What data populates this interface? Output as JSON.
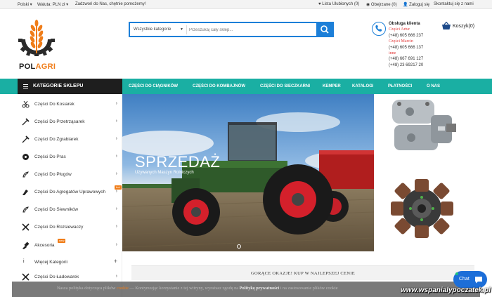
{
  "topbar": {
    "language": "Polski",
    "currency": "Waluta: PLN zł",
    "slogan": "Zadzwoń do Nas, chętnie pomożemy!",
    "wishlist": "Lista Ulubionych (0)",
    "viewed": "Obejrzane (0)",
    "login": "Zaloguj się",
    "contact": "Skontaktuj się z nami"
  },
  "logo": {
    "part1": "POL",
    "part2": "AGRI",
    "accent_color": "#f07d19"
  },
  "search": {
    "category": "Wszystkie kategorie",
    "placeholder": "Przeszukaj cały sklep...",
    "button_color": "#1c7fd8"
  },
  "contact": {
    "heading": "Obsługa klienta",
    "lines": [
      {
        "label": "Części Artur",
        "phone": "(+48) 605 666 237"
      },
      {
        "label": "Części Marcin",
        "phone": "(+48) 605 666 137"
      },
      {
        "label": "inne",
        "phone": "(+48) 667 691 127"
      },
      {
        "label": "",
        "phone": "(+48) 23 69217 20"
      }
    ]
  },
  "cart": {
    "label": "Koszyk(0)"
  },
  "nav": {
    "toggle": "KATEGORIE SKLEPU",
    "links": [
      "CZĘŚCI DO CIĄGNIKÓW",
      "CZĘŚCI DO KOMBAJNÓW",
      "CZĘŚCI DO SIECZKARNI",
      "KEMPER",
      "KATALOGI",
      "PŁATNOŚCI",
      "O NAS"
    ],
    "bar_color": "#1aafa3"
  },
  "sidebar": {
    "items": [
      {
        "label": "Części Do Kosiarek",
        "icon": "scissors-icon"
      },
      {
        "label": "Części Do Przetrząsarek",
        "icon": "rake-icon"
      },
      {
        "label": "Części Do Zgrabiarek",
        "icon": "rake-icon"
      },
      {
        "label": "Części Do Pras",
        "icon": "press-icon"
      },
      {
        "label": "Części Do Pługów",
        "icon": "plough-icon"
      },
      {
        "label": "Części Do Agregatów Uprawowych",
        "icon": "cultivator-icon",
        "badge": "hot"
      },
      {
        "label": "Części Do Siewników",
        "icon": "seeder-icon"
      },
      {
        "label": "Części Do Rozsiewaczy",
        "icon": "spreader-icon"
      },
      {
        "label": "Akcesoria",
        "icon": "accessories-icon",
        "badge": "new"
      },
      {
        "label": "Więcej Kategorii",
        "icon": "more-icon"
      },
      {
        "label": "Części Do Ładowarek",
        "icon": "loader-icon"
      }
    ]
  },
  "slider": {
    "title": "SPRZEDAŻ",
    "subtitle": "Używanych Maszyn Rolniczych"
  },
  "hot_deals": {
    "title": "GORĄCE OKAZJE! KUP W NAJLEPSZEJ CENIE"
  },
  "cookie": {
    "prefix": "Nasza polityka dotycząca plików",
    "cookie_word": "cookie",
    "middle": "— Kontynuując korzystanie z tej witryny, wyrażasz zgodę na",
    "policy_word": "Politykę prywatności",
    "suffix": "i na zastosowanie plików cookie"
  },
  "chat": {
    "label": "Chat"
  },
  "watermark": "www.wspanialypoczatek.pl"
}
